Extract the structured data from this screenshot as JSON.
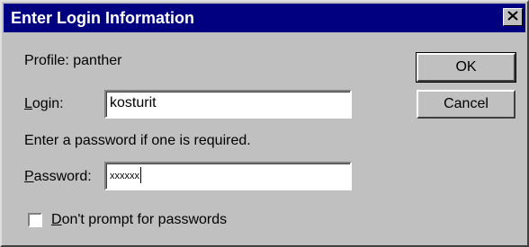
{
  "dialog": {
    "title": "Enter Login Information",
    "close_glyph": "✕"
  },
  "profile": {
    "text": "Profile: panther"
  },
  "login": {
    "label_access": "L",
    "label_rest": "ogin:",
    "value": "kosturit"
  },
  "password_hint": {
    "text": "Enter a password if one is required."
  },
  "password": {
    "label_access": "P",
    "label_rest": "assword:",
    "masked_value": "xxxxxx"
  },
  "dont_prompt": {
    "label_access": "D",
    "label_rest": "on't prompt for passwords",
    "checked": false
  },
  "buttons": {
    "ok_label": "OK",
    "cancel_label": "Cancel"
  }
}
